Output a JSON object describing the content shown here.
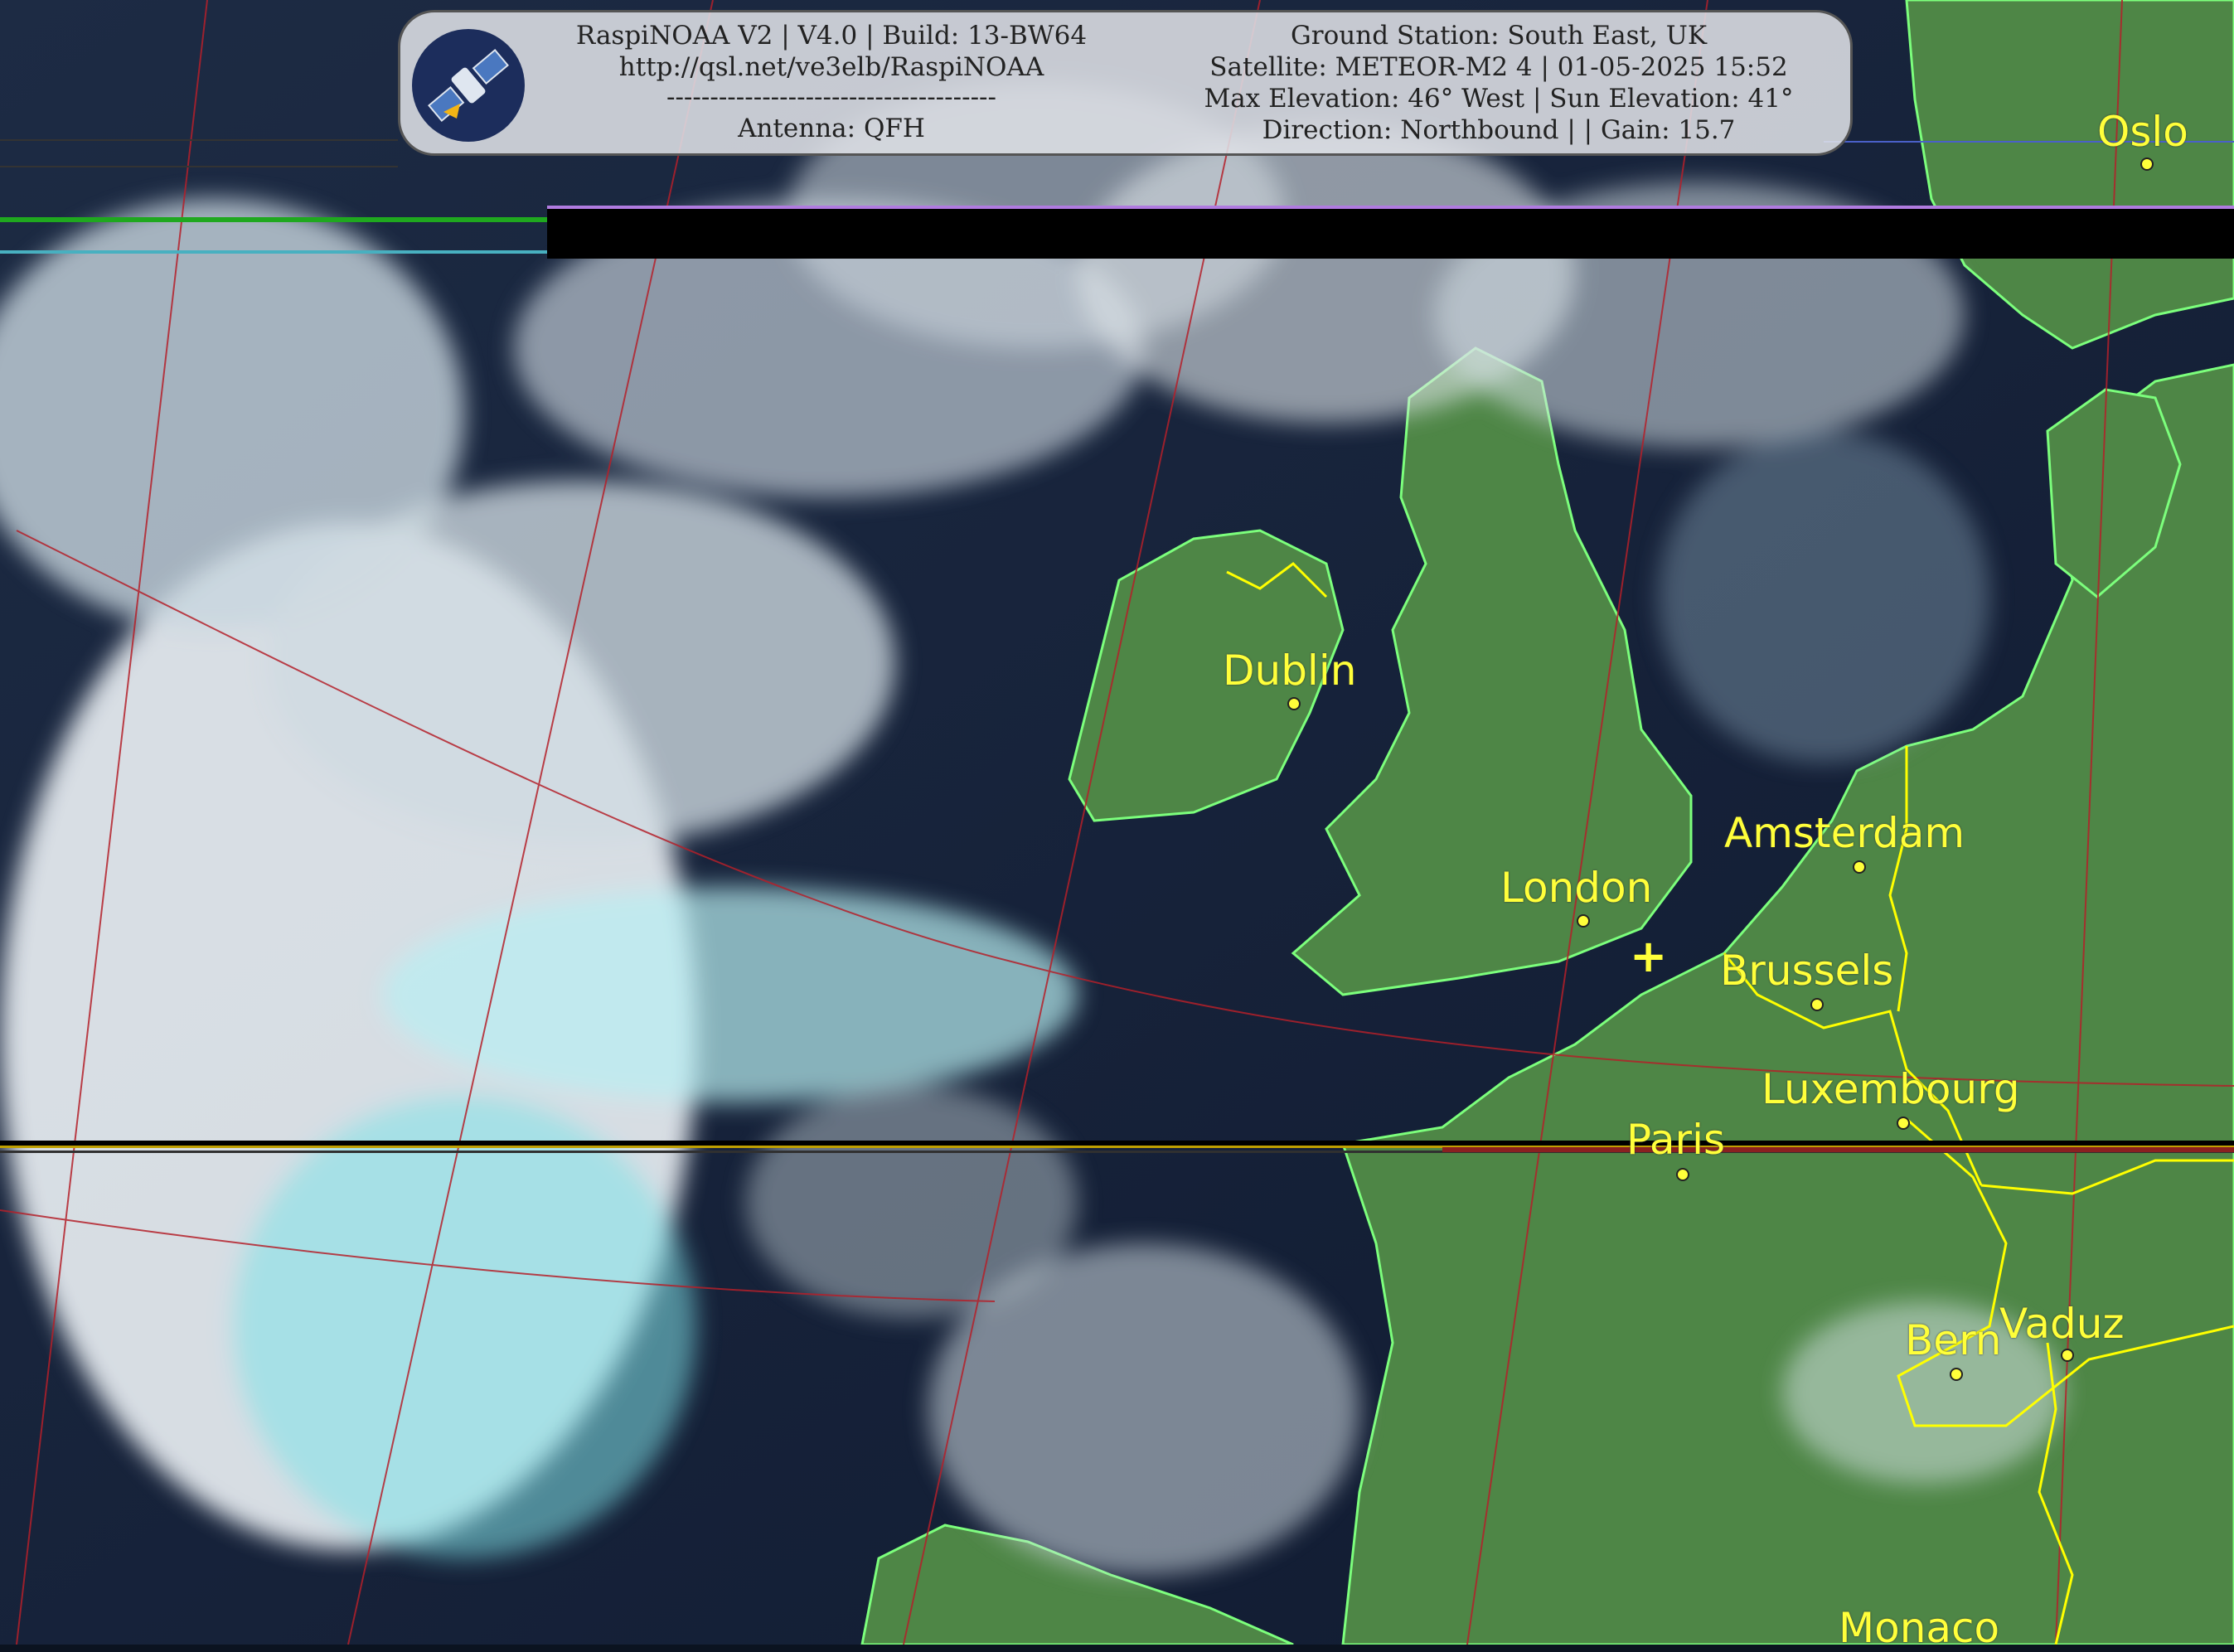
{
  "info": {
    "line1_left": "RaspiNOAA V2 | V4.0 | Build: 13-BW64",
    "line2_left": "http://qsl.net/ve3elb/RaspiNOAA",
    "line3_left": "--------------------------------------",
    "line4_left": "Antenna: QFH",
    "line1_right": "Ground Station: South East, UK",
    "line2_right": "Satellite: METEOR-M2 4 | 01-05-2025 15:52",
    "line3_right": "Max Elevation: 46° West | Sun Elevation: 41°",
    "line4_right": "Direction: Northbound | | Gain: 15.7"
  },
  "logo": {
    "icon": "satellite-icon",
    "bg_color": "#1c2d5c",
    "accent": "#f2b416"
  },
  "cities": [
    {
      "name": "Oslo"
    },
    {
      "name": "Dublin"
    },
    {
      "name": "Amsterdam"
    },
    {
      "name": "London"
    },
    {
      "name": "Brussels"
    },
    {
      "name": "Luxembourg"
    },
    {
      "name": "Paris"
    },
    {
      "name": "Bern"
    },
    {
      "name": "Vaduz"
    },
    {
      "name": "Monaco"
    }
  ],
  "ground_station_marker": "+",
  "colors": {
    "ocean": "#13203a",
    "land": "#4f8a45",
    "cloud": "#dbe7ee",
    "cloud_cyan": "#6fe0e6",
    "coastline": "#7cff7c",
    "borders": "#ffff00",
    "gridlines": "#b4202a",
    "label": "#ffff3a"
  }
}
